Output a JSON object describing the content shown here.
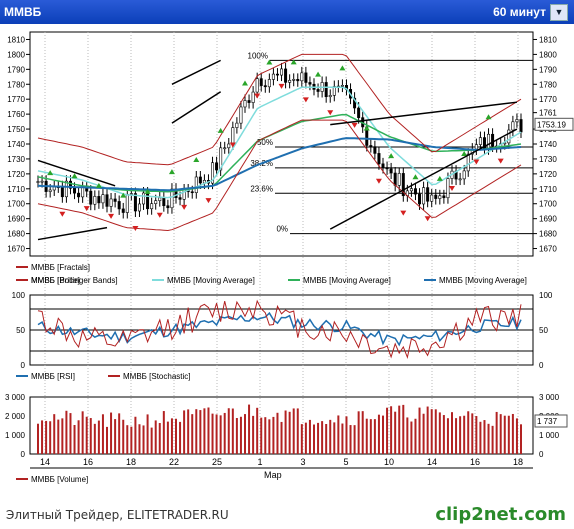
{
  "window": {
    "title": "ММВБ",
    "timeframe": "60 минут",
    "dropdown_icon": "chevron-down-icon"
  },
  "price_panel": {
    "y_ticks": [
      1670,
      1680,
      1690,
      1700,
      1710,
      1720,
      1730,
      1740,
      1750,
      1760,
      1770,
      1780,
      1790,
      1800,
      1810
    ],
    "right_y_ticks": [
      1670,
      1680,
      1690,
      1700,
      1710,
      1720,
      1730,
      1740,
      1750,
      1761,
      1770,
      1780,
      1790,
      1800,
      1810
    ],
    "last_price_label": "1753.19",
    "fib_levels": [
      {
        "label": "100%",
        "value": 1796
      },
      {
        "label": "50%",
        "value": 1738
      },
      {
        "label": "38.2%",
        "value": 1724
      },
      {
        "label": "23.6%",
        "value": 1707
      },
      {
        "label": "0%",
        "value": 1680
      }
    ],
    "legend": [
      {
        "text": "ММВБ [Fractals]",
        "color": "#b22222"
      },
      {
        "text": "ММВБ [Price]",
        "color": "#000000"
      },
      {
        "text": "ММВБ [Moving Average]",
        "color": "#7fdcdc"
      },
      {
        "text": "ММВБ [Moving Average]",
        "color": "#2fb15a"
      },
      {
        "text": "ММВБ [Moving Average]",
        "color": "#1f6fb0"
      },
      {
        "text": "ММВБ [Bollinger Bands]",
        "color": "#b22222"
      }
    ]
  },
  "rsi_panel": {
    "y_ticks": [
      0,
      50,
      100
    ],
    "levels": [
      20,
      50,
      80
    ],
    "legend": [
      {
        "text": "ММВБ [RSI]",
        "color": "#1f6fb0"
      },
      {
        "text": "ММВБ [Stochastic]",
        "color": "#b22222"
      }
    ]
  },
  "volume_panel": {
    "y_ticks": [
      "0",
      "1 000",
      "2 000",
      "3 000"
    ],
    "last_value_label": "1 737",
    "legend": [
      {
        "text": "ММВБ [Volume]",
        "color": "#b22222"
      }
    ]
  },
  "x_axis": {
    "labels": [
      "14",
      "16",
      "18",
      "22",
      "25",
      "1",
      "3",
      "5",
      "10",
      "14",
      "16",
      "18"
    ],
    "month_label": "Мар"
  },
  "footer": {
    "site": "Элитный Трейдер, ELITETRADER.RU",
    "logo": "clip2net.com"
  },
  "chart_data": [
    {
      "type": "line",
      "title": "ММВБ",
      "ylabel": "",
      "ylim": [
        1665,
        1815
      ],
      "x": [
        "14",
        "16",
        "18",
        "22",
        "25",
        "1",
        "3",
        "5",
        "10",
        "14",
        "16",
        "18"
      ],
      "series": [
        {
          "name": "ММВБ [Price]",
          "values": [
            1715,
            1707,
            1700,
            1702,
            1722,
            1785,
            1783,
            1772,
            1718,
            1700,
            1738,
            1753
          ]
        },
        {
          "name": "ММВБ [Moving Average]",
          "values": [
            1722,
            1716,
            1706,
            1704,
            1716,
            1764,
            1778,
            1778,
            1738,
            1712,
            1730,
            1748
          ]
        },
        {
          "name": "ММВБ [Moving Average]",
          "values": [
            1718,
            1712,
            1709,
            1708,
            1712,
            1742,
            1755,
            1760,
            1745,
            1735,
            1736,
            1740
          ]
        },
        {
          "name": "ММВБ [Moving Average]",
          "values": [
            1712,
            1711,
            1710,
            1709,
            1712,
            1726,
            1737,
            1744,
            1743,
            1738,
            1736,
            1738
          ]
        }
      ]
    },
    {
      "type": "line",
      "title": "",
      "ylim": [
        0,
        100
      ],
      "x": [
        "14",
        "16",
        "18",
        "22",
        "25",
        "1",
        "3",
        "5",
        "10",
        "14",
        "16",
        "18"
      ],
      "series": [
        {
          "name": "ММВБ [RSI]",
          "values": [
            55,
            45,
            40,
            50,
            60,
            70,
            60,
            55,
            35,
            40,
            55,
            60
          ]
        },
        {
          "name": "ММВБ [Stochastic]",
          "values": [
            70,
            35,
            30,
            55,
            75,
            85,
            55,
            45,
            20,
            30,
            65,
            70
          ]
        }
      ]
    },
    {
      "type": "bar",
      "title": "",
      "ylim": [
        0,
        3000
      ],
      "x": [
        "14",
        "16",
        "18",
        "22",
        "25",
        "1",
        "3",
        "5",
        "10",
        "14",
        "16",
        "18"
      ],
      "series": [
        {
          "name": "ММВБ [Volume]",
          "values": [
            2000,
            1800,
            1700,
            1900,
            2100,
            2300,
            2000,
            1900,
            2200,
            2100,
            2000,
            1737
          ]
        }
      ]
    }
  ]
}
